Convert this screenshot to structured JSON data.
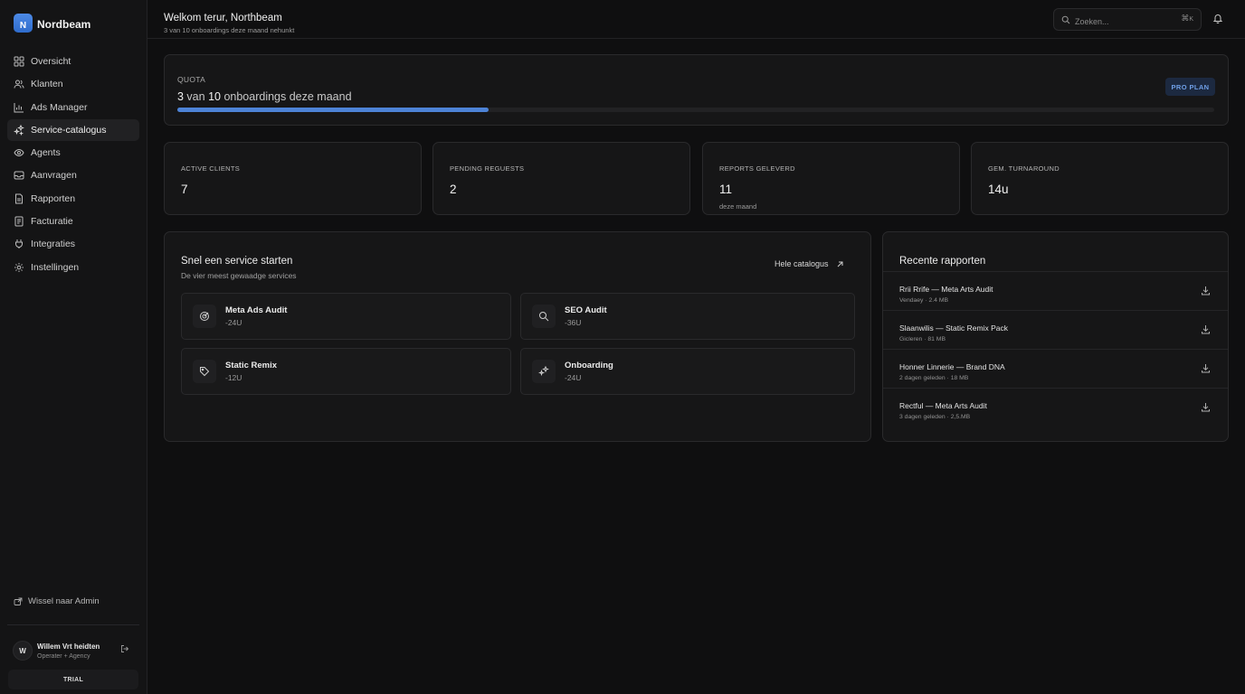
{
  "brand": {
    "logo_letter": "N",
    "name": "Nordbeam"
  },
  "sidebar": {
    "items": [
      {
        "label": "Oversicht",
        "icon": "grid-icon"
      },
      {
        "label": "Klanten",
        "icon": "users-icon"
      },
      {
        "label": "Ads Manager",
        "icon": "bar-chart-icon"
      },
      {
        "label": "Service-catalogus",
        "icon": "sparkles-icon",
        "active": true
      },
      {
        "label": "Agents",
        "icon": "eye-icon"
      },
      {
        "label": "Aanvragen",
        "icon": "inbox-icon"
      },
      {
        "label": "Rapporten",
        "icon": "file-icon"
      },
      {
        "label": "Facturatie",
        "icon": "receipt-icon"
      },
      {
        "label": "Integraties",
        "icon": "plug-icon"
      },
      {
        "label": "Instellingen",
        "icon": "gear-icon"
      }
    ],
    "switch_admin": "Wissel naar Admin",
    "user": {
      "initial": "W",
      "name": "Willem Vrt heidten",
      "role": "Operater + Agency"
    },
    "trial": "TRIAL"
  },
  "header": {
    "title": "Welkom terur, Northbeam",
    "subtitle": "3 van 10 onboardings deze maand nehunkt",
    "search_placeholder": "Zoeken...",
    "shortcut_cmd": "⌘",
    "shortcut_key": "K"
  },
  "quota": {
    "label": "QUOTA",
    "used": "3",
    "middle": " van ",
    "total": "10",
    "suffix": " onboardings deze maand",
    "progress_fraction": 0.3,
    "plan_badge": "PRO PLAN"
  },
  "stats": [
    {
      "label": "ACTIVE CLIENTS",
      "value": "7",
      "sub": ""
    },
    {
      "label": "PENDING REGUESTS",
      "value": "2",
      "sub": ""
    },
    {
      "label": "REPORTS GELEVERD",
      "value": "11",
      "sub": "deze maand"
    },
    {
      "label": "GEM. TURNAROUND",
      "value": "14u",
      "sub": ""
    }
  ],
  "quick": {
    "title": "Snel een service starten",
    "subtitle": "De vier meest gewaadge services",
    "catalog_link": "Hele catalogus",
    "services": [
      {
        "name": "Meta Ads Audit",
        "time": "-24U",
        "icon": "target-icon"
      },
      {
        "name": "SEO Audit",
        "time": "-36U",
        "icon": "search-icon"
      },
      {
        "name": "Static Remix",
        "time": "-12U",
        "icon": "tag-icon"
      },
      {
        "name": "Onboarding",
        "time": "-24U",
        "icon": "sparkles-icon"
      }
    ]
  },
  "reports": {
    "title": "Recente rapporten",
    "items": [
      {
        "name": "Rrii Rrife — Meta Arts Audit",
        "meta": "Vendaey · 2.4 MB"
      },
      {
        "name": "Slaanwilis — Static Remix Pack",
        "meta": "Gicleren · 81 MB"
      },
      {
        "name": "Honner Linnerie — Brand DNA",
        "meta": "2 dagen geleden · 18 MB"
      },
      {
        "name": "Rectful — Meta Arts Audit",
        "meta": "3 dagen geleden · 2,5.MB"
      }
    ]
  },
  "colors": {
    "accent": "#4d83d6",
    "badge_bg": "#1c2940",
    "badge_text": "#6f9fe6"
  }
}
